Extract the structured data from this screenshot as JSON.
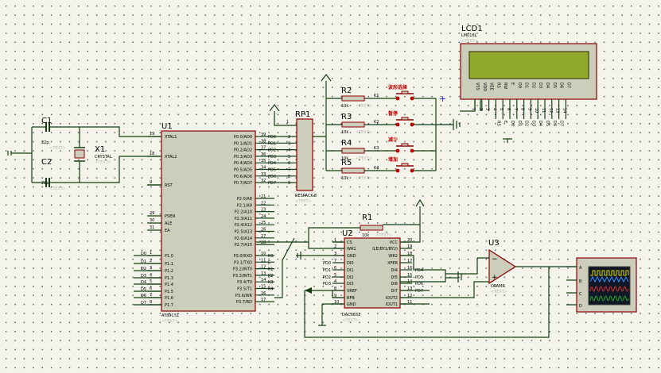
{
  "c1": {
    "ref": "C1",
    "value": "22p",
    "text": "<TEXT>"
  },
  "c2": {
    "ref": "C2",
    "value": "22p",
    "text": "<TEXT>"
  },
  "x1": {
    "ref": "X1",
    "type": "CRYSTAL",
    "text": "<TEXT>"
  },
  "u1": {
    "ref": "U1",
    "part": "AT89C51",
    "text": "<TEXT>",
    "left_pins": [
      {
        "num": "19",
        "name": "XTAL1"
      },
      {
        "num": "18",
        "name": "XTAL2"
      },
      {
        "num": "9",
        "name": "RST"
      },
      {
        "num": "29",
        "name": "PSEN"
      },
      {
        "num": "30",
        "name": "ALE"
      },
      {
        "num": "31",
        "name": "EA"
      },
      {
        "num": "1",
        "name": "P1.0",
        "net": "D0"
      },
      {
        "num": "2",
        "name": "P1.1",
        "net": "D1"
      },
      {
        "num": "3",
        "name": "P1.2",
        "net": "D2"
      },
      {
        "num": "4",
        "name": "P1.3",
        "net": "D3"
      },
      {
        "num": "5",
        "name": "P1.4",
        "net": "D4"
      },
      {
        "num": "6",
        "name": "P1.5",
        "net": "D5"
      },
      {
        "num": "7",
        "name": "P1.6",
        "net": "D6"
      },
      {
        "num": "8",
        "name": "P1.7",
        "net": "D7"
      }
    ],
    "right_pins": [
      {
        "num": "39",
        "name": "P0.0/AD0",
        "net": "PD0"
      },
      {
        "num": "38",
        "name": "P0.1/AD1",
        "net": "PD1"
      },
      {
        "num": "37",
        "name": "P0.2/AD2",
        "net": "PD2"
      },
      {
        "num": "36",
        "name": "P0.3/AD3",
        "net": "PD3"
      },
      {
        "num": "35",
        "name": "P0.4/AD4",
        "net": "PD4"
      },
      {
        "num": "34",
        "name": "P0.5/AD5",
        "net": "PD5"
      },
      {
        "num": "33",
        "name": "P0.6/AD6",
        "net": "PD6"
      },
      {
        "num": "32",
        "name": "P0.7/AD7",
        "net": "PD7"
      },
      {
        "num": "21",
        "name": "P2.0/A8"
      },
      {
        "num": "22",
        "name": "P2.1/A9"
      },
      {
        "num": "23",
        "name": "P2.2/A10"
      },
      {
        "num": "24",
        "name": "P2.3/A11"
      },
      {
        "num": "25",
        "name": "P2.4/A12"
      },
      {
        "num": "26",
        "name": "P2.5/A13"
      },
      {
        "num": "27",
        "name": "P2.6/A14"
      },
      {
        "num": "28",
        "name": "P2.7/A15"
      },
      {
        "num": "10",
        "name": "P3.0/RXD",
        "net": "RS"
      },
      {
        "num": "11",
        "name": "P3.1/TXD",
        "net": "E"
      },
      {
        "num": "12",
        "name": "P3.2/INT0",
        "net": "K1"
      },
      {
        "num": "13",
        "name": "P3.3/INT1",
        "net": "K2"
      },
      {
        "num": "14",
        "name": "P3.4/T0",
        "net": "K3"
      },
      {
        "num": "15",
        "name": "P3.5/T1",
        "net": "K4"
      },
      {
        "num": "16",
        "name": "P3.6/WR"
      },
      {
        "num": "17",
        "name": "P3.7/RD"
      }
    ]
  },
  "rp1": {
    "ref": "RP1",
    "part": "RESPACK-8",
    "text": "<TEXT>",
    "pin1": "1",
    "pins": [
      "2",
      "3",
      "4",
      "5",
      "6",
      "7",
      "8",
      "9"
    ]
  },
  "resistors": [
    {
      "ref": "R2",
      "value": "10k",
      "text": "<TEXT>"
    },
    {
      "ref": "R3",
      "value": "10k",
      "text": "<TEXT>"
    },
    {
      "ref": "R4",
      "value": "10k",
      "text": "<TEXT>"
    },
    {
      "ref": "R5",
      "value": "10k",
      "text": "<TEXT>"
    }
  ],
  "keys": [
    {
      "ref": "K1",
      "caption": "波形选择"
    },
    {
      "ref": "K2",
      "caption": "暂停"
    },
    {
      "ref": "K3",
      "caption": "减少"
    },
    {
      "ref": "K4",
      "caption": "增加"
    }
  ],
  "r1": {
    "ref": "R1",
    "value": "10k",
    "text": "<TEXT>"
  },
  "lcd": {
    "ref": "LCD1",
    "part": "LM016L",
    "text": "<TEXT>",
    "pin_names": [
      "VSS",
      "VDD",
      "VEE",
      "RS",
      "RW",
      "E",
      "D0",
      "D1",
      "D2",
      "D3",
      "D4",
      "D5",
      "D6",
      "D7"
    ],
    "pin_nums": [
      "1",
      "2",
      "3",
      "4",
      "5",
      "6",
      "7",
      "8",
      "9",
      "10",
      "11",
      "12",
      "13",
      "14"
    ],
    "nets": [
      "RS",
      "E",
      "D0",
      "D1",
      "D2",
      "D3",
      "D4",
      "D5",
      "D6",
      "D7"
    ]
  },
  "u2": {
    "ref": "U2",
    "part": "DAC0832",
    "text": "<TEXT>",
    "left_pins": [
      {
        "num": "1",
        "name": "CS"
      },
      {
        "num": "2",
        "name": "WR1"
      },
      {
        "num": "3",
        "name": "GND"
      },
      {
        "num": "7",
        "name": "DI0",
        "net": "PD0"
      },
      {
        "num": "6",
        "name": "DI1",
        "net": "PD1"
      },
      {
        "num": "5",
        "name": "DI2",
        "net": "PD2"
      },
      {
        "num": "4",
        "name": "DI3",
        "net": "PD3"
      },
      {
        "num": "8",
        "name": "VREF"
      },
      {
        "num": "9",
        "name": "RFB"
      },
      {
        "num": "10",
        "name": "GND"
      }
    ],
    "right_pins": [
      {
        "num": "20",
        "name": "VCC"
      },
      {
        "num": "19",
        "name": "ILE(BY1/BY2)"
      },
      {
        "num": "18",
        "name": "WR2"
      },
      {
        "num": "17",
        "name": "XFER"
      },
      {
        "num": "16",
        "name": "DI4",
        "net": "PD4"
      },
      {
        "num": "15",
        "name": "DI5",
        "net": "PD5"
      },
      {
        "num": "14",
        "name": "DI6",
        "net": "PD6"
      },
      {
        "num": "13",
        "name": "DI7",
        "net": "PD7"
      },
      {
        "num": "12",
        "name": "IOUT2"
      },
      {
        "num": "11",
        "name": "IOUT1"
      }
    ]
  },
  "u3": {
    "ref": "U3",
    "part": "OPAMP",
    "text": "<TEXT>"
  },
  "scope": {
    "channels": [
      "A",
      "B",
      "C",
      "D"
    ],
    "colors": [
      "#d8d800",
      "#3a8cff",
      "#e03030",
      "#20b020"
    ]
  }
}
